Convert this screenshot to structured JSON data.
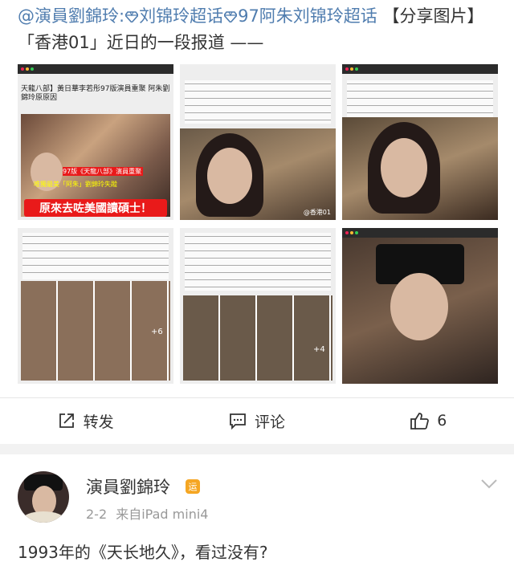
{
  "post": {
    "mention": "@演員劉錦玲:",
    "topic1_icon": "super-topic-icon",
    "topic1": "刘锦玲超话",
    "topic2_icon": "super-topic-icon",
    "topic2": "97阿朱刘锦玲超话",
    "rest": " 【分享图片】「香港01」近日的一段报道 ——"
  },
  "images": {
    "banner_text": "原來去咗美國讀碩士！",
    "headline": "天龍八部】黃日華李若彤97版演員重聚 阿朱劉錦玲原原因",
    "badge1": "97版《天龍八部》演員重聚",
    "badge2": "唯獨最美「阿朱」劉錦玲失蹤",
    "plus1": "+6",
    "plus2": "+4",
    "watermark": "@香港01"
  },
  "actions": {
    "repost_icon": "repost-icon",
    "repost_label": "转发",
    "comment_icon": "comment-icon",
    "comment_label": "评论",
    "like_icon": "thumbs-up-icon",
    "like_count": "6"
  },
  "reply": {
    "username": "演員劉錦玲",
    "badge": "运",
    "date": "2-2",
    "source": "来自iPad mini4",
    "text": "1993年的《天长地久》，看过没有?"
  },
  "colors": {
    "link": "#507daf",
    "text": "#333333",
    "muted": "#999999",
    "badge": "#f5a623",
    "banner": "#e91a1a"
  }
}
